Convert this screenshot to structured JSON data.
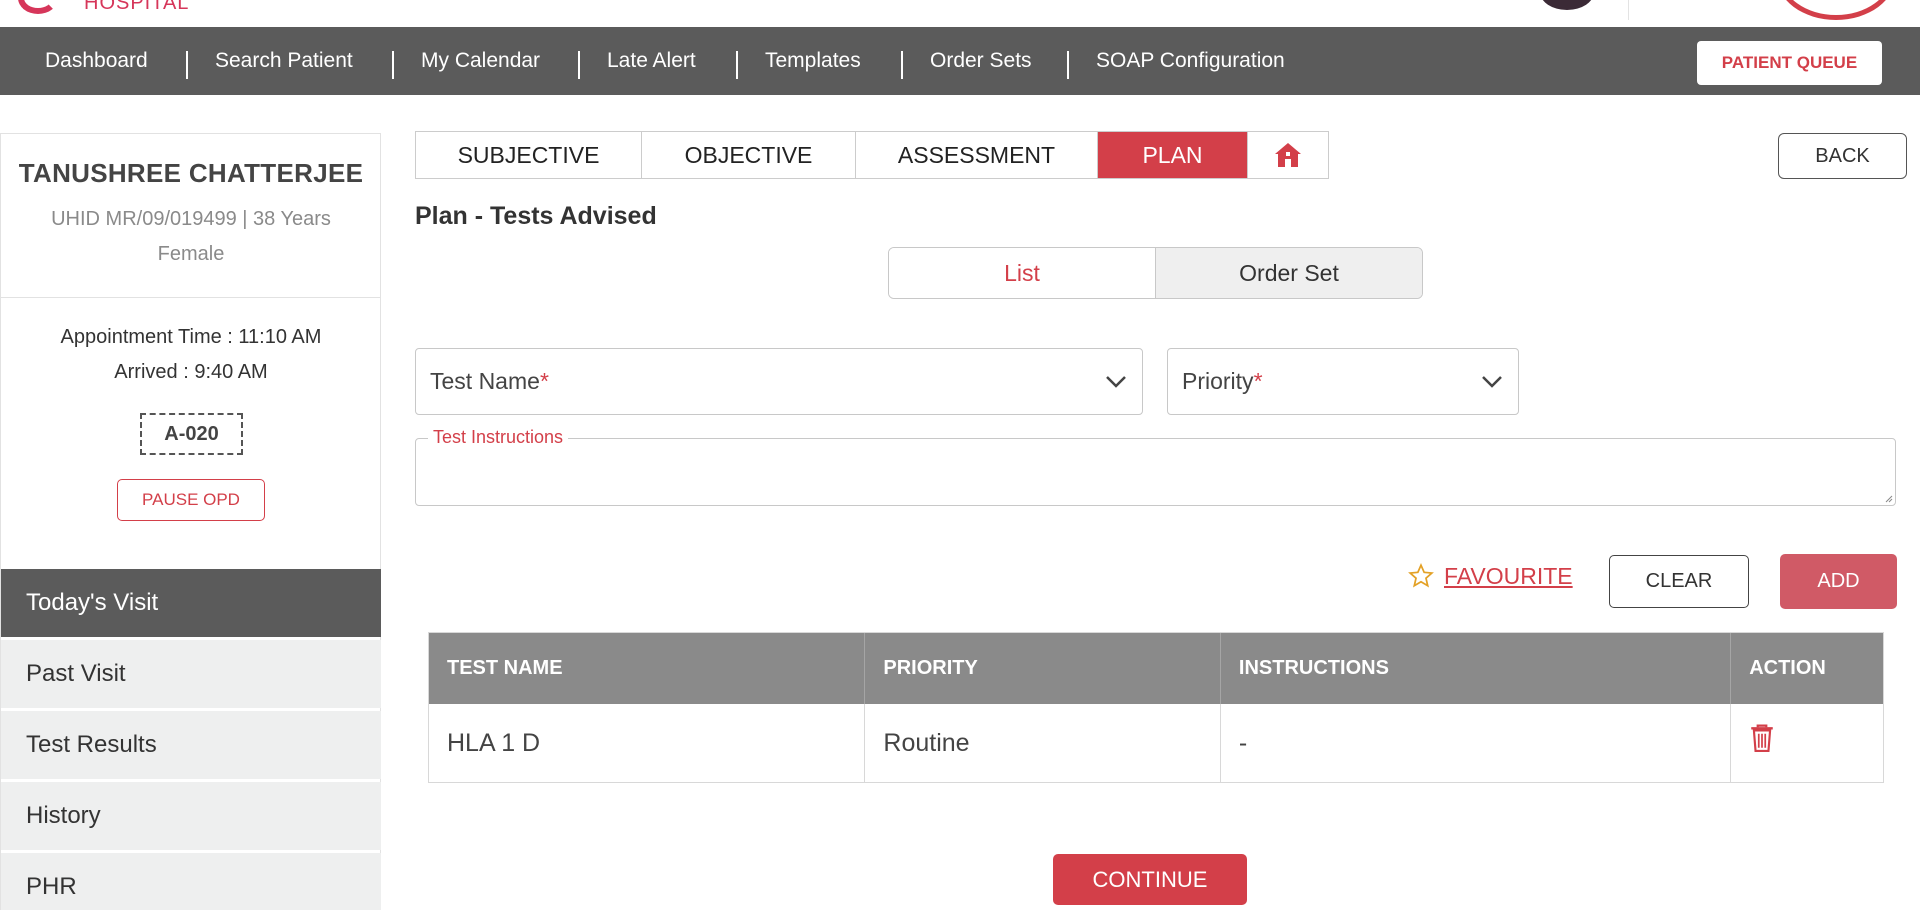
{
  "brand": {
    "logo_text": "HOSPITAL",
    "accent_color": "#d33f49"
  },
  "nav": {
    "items": [
      "Dashboard",
      "Search Patient",
      "My Calendar",
      "Late Alert",
      "Templates",
      "Order Sets",
      "SOAP Configuration"
    ],
    "queue_button": "PATIENT QUEUE"
  },
  "patient": {
    "name": "TANUSHREE CHATTERJEE",
    "uhid_age": "UHID MR/09/019499 | 38 Years",
    "gender": "Female",
    "appointment_time": "Appointment Time : 11:10 AM",
    "arrived": "Arrived : 9:40 AM",
    "token": "A-020",
    "pause_button": "PAUSE OPD"
  },
  "sidebar": {
    "items": [
      {
        "label": "Today's Visit",
        "active": true
      },
      {
        "label": "Past Visit",
        "active": false
      },
      {
        "label": "Test Results",
        "active": false
      },
      {
        "label": "History",
        "active": false
      },
      {
        "label": "PHR",
        "active": false
      }
    ]
  },
  "soap_tabs": {
    "items": [
      {
        "label": "SUBJECTIVE",
        "active": false
      },
      {
        "label": "OBJECTIVE",
        "active": false
      },
      {
        "label": "ASSESSMENT",
        "active": false
      },
      {
        "label": "PLAN",
        "active": true
      }
    ],
    "home_icon": "home-icon"
  },
  "back_button": "BACK",
  "section_title": "Plan - Tests Advised",
  "view_toggle": {
    "list": "List",
    "order_set": "Order Set",
    "selected": "List"
  },
  "form": {
    "test_name_label": "Test Name",
    "priority_label": "Priority",
    "required_mark": "*",
    "instructions_label": "Test Instructions",
    "instructions_value": ""
  },
  "actions": {
    "favourite": "FAVOURITE",
    "clear": "CLEAR",
    "add": "ADD"
  },
  "table": {
    "headers": [
      "TEST NAME",
      "PRIORITY",
      "INSTRUCTIONS",
      "ACTION"
    ],
    "rows": [
      {
        "test_name": "HLA 1 D",
        "priority": "Routine",
        "instructions": "-",
        "action_icon": "trash-icon"
      }
    ]
  },
  "continue_button": "CONTINUE"
}
